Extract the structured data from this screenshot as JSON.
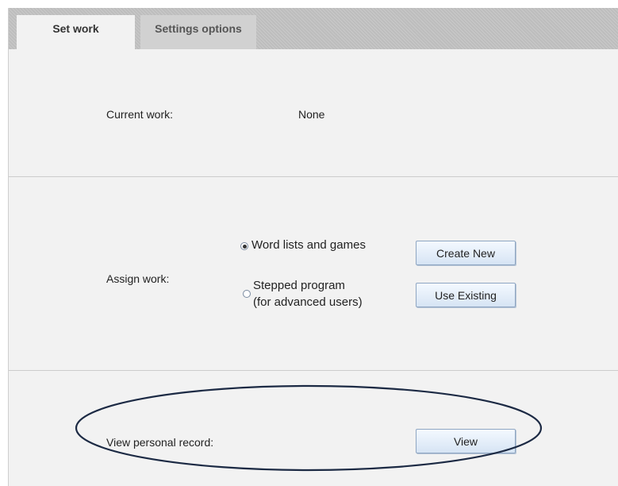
{
  "tabs": [
    {
      "label": "Set work",
      "active": true
    },
    {
      "label": "Settings options",
      "active": false
    }
  ],
  "current_work": {
    "label": "Current work:",
    "value": "None"
  },
  "assign_work": {
    "label": "Assign work:",
    "options": [
      {
        "label": "Word lists and games",
        "checked": true
      },
      {
        "label_line1": "Stepped program",
        "label_line2": "(for advanced users)",
        "checked": false
      }
    ],
    "create_new_label": "Create New",
    "use_existing_label": "Use Existing"
  },
  "personal_record": {
    "label": "View personal record:",
    "view_label": "View"
  },
  "colors": {
    "panel_bg": "#f2f2f2",
    "tabbar_bg": "#bdbdbd",
    "button_gradient_top": "#f4f9ff",
    "button_gradient_bottom": "#d6e4f4",
    "ellipse_stroke": "#1c2a44"
  }
}
